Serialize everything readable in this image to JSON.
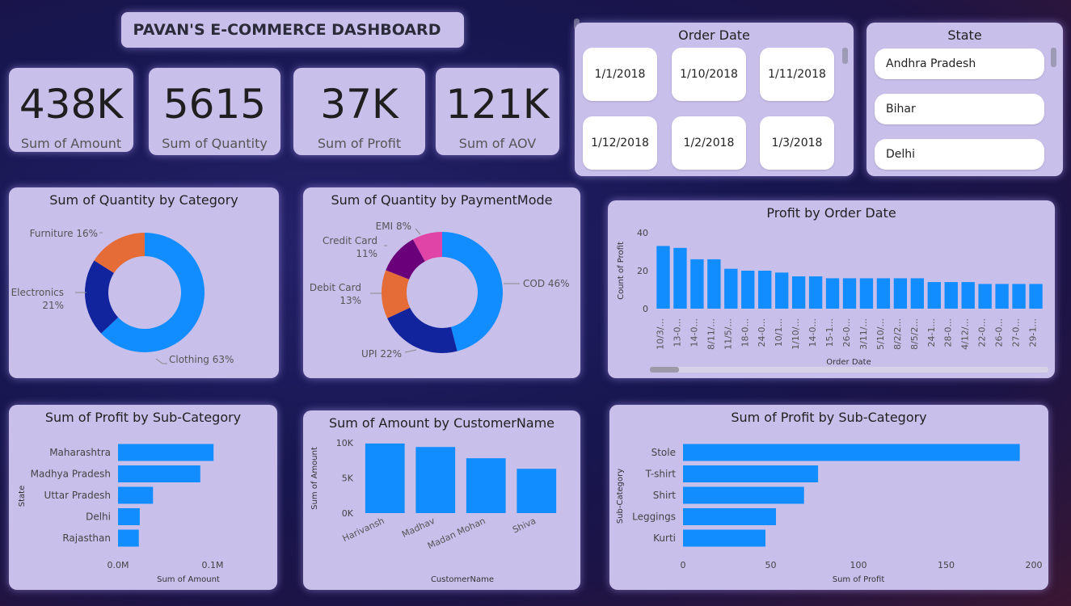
{
  "dashboard": {
    "title": "PAVAN'S E-COMMERCE DASHBOARD"
  },
  "kpis": [
    {
      "value": "438K",
      "label": "Sum of Amount"
    },
    {
      "value": "5615",
      "label": "Sum of Quantity"
    },
    {
      "value": "37K",
      "label": "Sum of Profit"
    },
    {
      "value": "121K",
      "label": "Sum of AOV"
    }
  ],
  "order_date_slicer": {
    "title": "Order Date",
    "items": [
      "1/1/2018",
      "1/10/2018",
      "1/11/2018",
      "1/12/2018",
      "1/2/2018",
      "1/3/2018"
    ]
  },
  "state_slicer": {
    "title": "State",
    "items": [
      "Andhra Pradesh",
      "Bihar",
      "Delhi"
    ]
  },
  "colors": {
    "bar": "#118dff",
    "donut_blue": "#118dff",
    "donut_navy": "#12239e",
    "donut_orange": "#e66c37",
    "donut_purple": "#6b007b",
    "donut_pink": "#e044a7"
  },
  "chart_data": [
    {
      "type": "pie",
      "title": "Sum of Quantity by Category",
      "labels": [
        "Clothing",
        "Electronics",
        "Furniture"
      ],
      "values": [
        63,
        21,
        16
      ],
      "label_text": [
        "Clothing 63%",
        "Electronics",
        "21%",
        "Furniture 16%"
      ]
    },
    {
      "type": "pie",
      "title": "Sum of Quantity by PaymentMode",
      "labels": [
        "COD",
        "UPI",
        "Debit Card",
        "Credit Card",
        "EMI"
      ],
      "values": [
        46,
        22,
        13,
        11,
        8
      ],
      "label_text": [
        "COD 46%",
        "UPI 22%",
        "Debit Card",
        "13%",
        "Credit Card",
        "11%",
        "EMI 8%"
      ]
    },
    {
      "type": "bar",
      "title": "Profit by Order Date",
      "xlabel": "Order Date",
      "ylabel": "Count of Profit",
      "yticks": [
        "0",
        "20",
        "40"
      ],
      "ylim": [
        0,
        40
      ],
      "categories": [
        "10/3/...",
        "13-0...",
        "14-0...",
        "8/11/...",
        "11/5/...",
        "18-0...",
        "24-0...",
        "10/1...",
        "1/10/...",
        "14-0...",
        "15-1...",
        "26-0...",
        "3/11/...",
        "5/10/...",
        "8/2/2...",
        "8/5/2...",
        "24-1...",
        "28-0...",
        "4/12/...",
        "22-0...",
        "26-0...",
        "27-0...",
        "29-1..."
      ],
      "values": [
        33,
        32,
        26,
        26,
        21,
        20,
        20,
        19,
        17,
        17,
        16,
        16,
        16,
        16,
        16,
        16,
        14,
        14,
        14,
        13,
        13,
        13,
        13
      ]
    },
    {
      "type": "bar",
      "orientation": "horizontal",
      "title": "Sum of Profit by Sub-Category",
      "xlabel": "Sum of Amount",
      "ylabel": "State",
      "xticks": [
        "0.0M",
        "0.1M"
      ],
      "xlim": [
        0,
        0.1
      ],
      "categories": [
        "Maharashtra",
        "Madhya Pradesh",
        "Uttar Pradesh",
        "Delhi",
        "Rajasthan"
      ],
      "values": [
        0.101,
        0.087,
        0.037,
        0.023,
        0.022
      ]
    },
    {
      "type": "bar",
      "title": "Sum of Amount by CustomerName",
      "xlabel": "CustomerName",
      "ylabel": "Sum of Amount",
      "yticks": [
        "0K",
        "5K",
        "10K"
      ],
      "ylim": [
        0,
        10000
      ],
      "categories": [
        "Harivansh",
        "Madhav",
        "Madan Mohan",
        "Shiva"
      ],
      "values": [
        9900,
        9400,
        7800,
        6300
      ]
    },
    {
      "type": "bar",
      "orientation": "horizontal",
      "title": "Sum of Profit by Sub-Category",
      "xlabel": "Sum of Profit",
      "ylabel": "Sub-Category",
      "xticks": [
        "0",
        "50",
        "100",
        "150",
        "200"
      ],
      "xlim": [
        0,
        200
      ],
      "categories": [
        "Stole",
        "T-shirt",
        "Shirt",
        "Leggings",
        "Kurti"
      ],
      "values": [
        192,
        77,
        69,
        53,
        47
      ]
    }
  ]
}
